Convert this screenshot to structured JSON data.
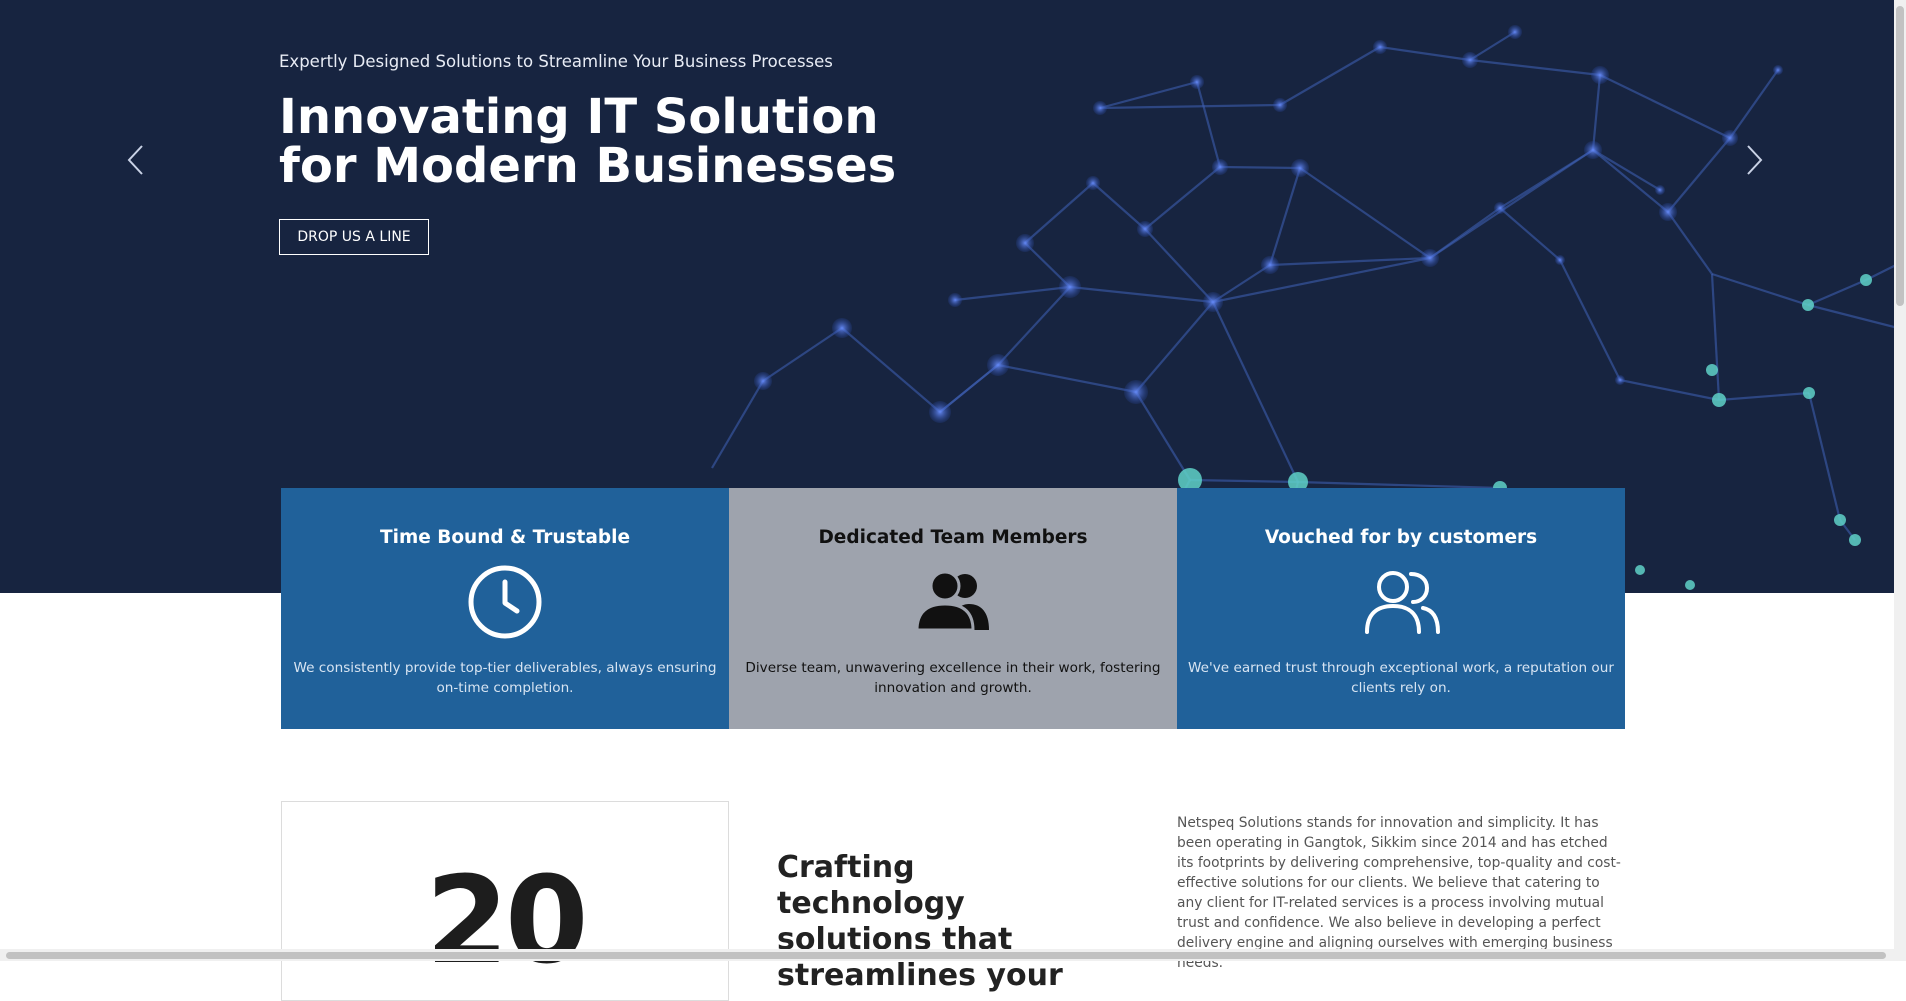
{
  "hero": {
    "subtitle": "Expertly Designed Solutions to Streamline Your Business Processes",
    "title": "Innovating IT Solution for Modern Businesses",
    "cta_label": "DROP US A LINE",
    "background_color": "#172440"
  },
  "features": [
    {
      "title": "Time Bound & Trustable",
      "icon": "clock-icon",
      "text": "We consistently provide top-tier deliverables, always ensuring on-time completion.",
      "color": "#20619a"
    },
    {
      "title": "Dedicated Team Members",
      "icon": "team-icon",
      "text": "Diverse team, unwavering excellence in their work, fostering innovation and growth.",
      "color": "#9ea3ad"
    },
    {
      "title": "Vouched for by customers",
      "icon": "users-outline-icon",
      "text": "We've earned trust through exceptional work, a reputation our clients rely on.",
      "color": "#20619a"
    }
  ],
  "stat": {
    "number": "20"
  },
  "crafting_heading": "Crafting technology solutions that streamlines your",
  "about_text": "Netspeq Solutions stands for innovation and simplicity. It has been operating in Gangtok, Sikkim since 2014 and has etched its footprints by delivering comprehensive, top-quality and cost-effective solutions for our clients. We believe that catering to any client for IT-related services is a process involving mutual trust and confidence. We also believe in developing a perfect delivery engine and aligning ourselves with emerging business needs."
}
